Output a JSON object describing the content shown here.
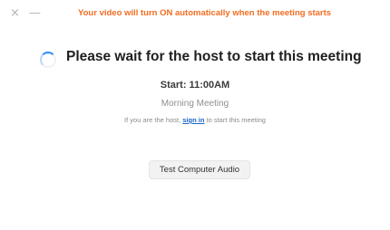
{
  "window": {
    "close_glyph": "×",
    "minimize_glyph": "—",
    "notice": "Your video will turn ON automatically when the meeting starts",
    "notice_color": "#f26d21"
  },
  "waiting": {
    "spinner_icon": "loading-spinner-icon",
    "accent_color": "#2d8cff",
    "headline": "Please wait for the host to start this meeting",
    "start_time": "Start: 11:00AM",
    "meeting_name": "Morning Meeting",
    "host_prefix": "If you are the host, ",
    "sign_in_label": "sign in",
    "host_suffix": " to start this meeting",
    "link_color": "#1a66c9"
  },
  "actions": {
    "test_audio_label": "Test Computer Audio"
  }
}
